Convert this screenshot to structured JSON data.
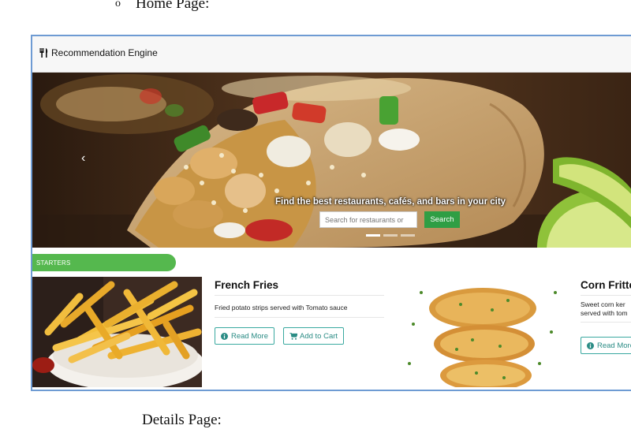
{
  "document": {
    "bullet_mark": "o",
    "heading": "Home Page:",
    "next_heading": "Details Page:"
  },
  "navbar": {
    "brand": "Recommendation Engine",
    "brand_icon": "utensils-icon"
  },
  "hero": {
    "tagline": "Find the best restaurants, cafés, and bars in your city",
    "search_placeholder": "Search for restaurants or",
    "search_button": "Search",
    "prev_icon": "chevron-left-icon",
    "slides": 3,
    "active_slide": 1
  },
  "section": {
    "title": "STARTERS"
  },
  "cards": [
    {
      "title": "French Fries",
      "description": "Fried potato strips served with Tomato sauce",
      "read_more": "Read More",
      "add_to_cart": "Add to Cart"
    },
    {
      "title": "Corn Fritte",
      "description_line1": "Sweet corn ker",
      "description_line2": "served with tom",
      "read_more": "Read More"
    }
  ],
  "colors": {
    "frame_border": "#6e9bd3",
    "search_button": "#2f9e44",
    "section_bar": "#55b84e",
    "button_outline": "#3aa9a0"
  }
}
